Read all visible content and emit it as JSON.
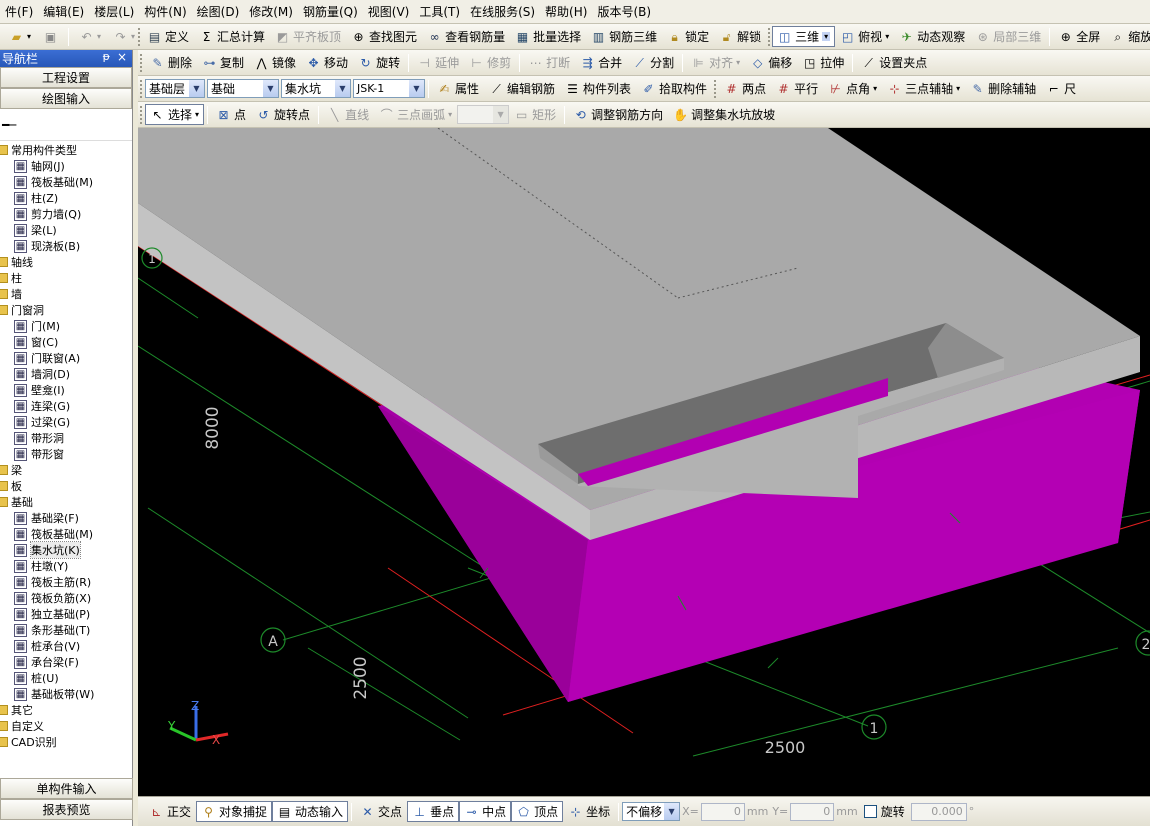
{
  "menu": [
    "件(F)",
    "编辑(E)",
    "楼层(L)",
    "构件(N)",
    "绘图(D)",
    "修改(M)",
    "钢筋量(Q)",
    "视图(V)",
    "工具(T)",
    "在线服务(S)",
    "帮助(H)",
    "版本号(B)"
  ],
  "toolbar1": {
    "define": "定义",
    "sum": "汇总计算",
    "flat_top": "平齐板顶",
    "find": "查找图元",
    "view_rebar": "查看钢筋量",
    "batch_select": "批量选择",
    "rebar_3d": "钢筋三维",
    "lock": "锁定",
    "unlock": "解锁",
    "view_3d": "三维",
    "top_view": "俯视",
    "dynamic_view": "动态观察",
    "local_3d": "局部三维",
    "fullscreen": "全屏",
    "zoom": "缩放"
  },
  "toolbar2": {
    "delete": "删除",
    "copy": "复制",
    "mirror": "镜像",
    "move": "移动",
    "rotate": "旋转",
    "extend": "延伸",
    "trim": "修剪",
    "break": "打断",
    "merge": "合并",
    "split": "分割",
    "align": "对齐",
    "offset": "偏移",
    "stretch": "拉伸",
    "set_grip": "设置夹点"
  },
  "toolbar3": {
    "floor": "基础层",
    "category": "基础",
    "type": "集水坑",
    "instance": "JSK-1",
    "property": "属性",
    "edit_rebar": "编辑钢筋",
    "component_list": "构件列表",
    "pick": "拾取构件",
    "two_point": "两点",
    "parallel": "平行",
    "point_angle": "点角",
    "three_point_axis": "三点辅轴",
    "delete_axis": "删除辅轴",
    "dimension": "尺"
  },
  "toolbar4": {
    "select": "选择",
    "point": "点",
    "rotate_point": "旋转点",
    "line": "直线",
    "arc": "三点画弧",
    "rect": "矩形",
    "adjust_rebar_dir": "调整钢筋方向",
    "adjust_slope": "调整集水坑放坡"
  },
  "panel": {
    "title": "导航栏",
    "pin": "ᵽ",
    "close": "×",
    "project_settings": "工程设置",
    "drawing_input": "绘图输入",
    "tree": [
      {
        "label": "常用构件类型",
        "kind": "folder",
        "level": 0
      },
      {
        "label": "轴网(J)",
        "kind": "leaf",
        "level": 1
      },
      {
        "label": "筏板基础(M)",
        "kind": "leaf",
        "level": 1
      },
      {
        "label": "柱(Z)",
        "kind": "leaf",
        "level": 1
      },
      {
        "label": "剪力墙(Q)",
        "kind": "leaf",
        "level": 1
      },
      {
        "label": "梁(L)",
        "kind": "leaf",
        "level": 1
      },
      {
        "label": "现浇板(B)",
        "kind": "leaf",
        "level": 1
      },
      {
        "label": "轴线",
        "kind": "folder",
        "level": 0
      },
      {
        "label": "柱",
        "kind": "folder",
        "level": 0
      },
      {
        "label": "墙",
        "kind": "folder",
        "level": 0
      },
      {
        "label": "门窗洞",
        "kind": "folder",
        "level": 0
      },
      {
        "label": "门(M)",
        "kind": "leaf",
        "level": 1
      },
      {
        "label": "窗(C)",
        "kind": "leaf",
        "level": 1
      },
      {
        "label": "门联窗(A)",
        "kind": "leaf",
        "level": 1
      },
      {
        "label": "墙洞(D)",
        "kind": "leaf",
        "level": 1
      },
      {
        "label": "壁龛(I)",
        "kind": "leaf",
        "level": 1
      },
      {
        "label": "连梁(G)",
        "kind": "leaf",
        "level": 1
      },
      {
        "label": "过梁(G)",
        "kind": "leaf",
        "level": 1
      },
      {
        "label": "带形洞",
        "kind": "leaf",
        "level": 1
      },
      {
        "label": "带形窗",
        "kind": "leaf",
        "level": 1
      },
      {
        "label": "梁",
        "kind": "folder",
        "level": 0
      },
      {
        "label": "板",
        "kind": "folder",
        "level": 0
      },
      {
        "label": "基础",
        "kind": "folder",
        "level": 0
      },
      {
        "label": "基础梁(F)",
        "kind": "leaf",
        "level": 1
      },
      {
        "label": "筏板基础(M)",
        "kind": "leaf",
        "level": 1
      },
      {
        "label": "集水坑(K)",
        "kind": "leaf",
        "level": 1,
        "selected": true
      },
      {
        "label": "柱墩(Y)",
        "kind": "leaf",
        "level": 1
      },
      {
        "label": "筏板主筋(R)",
        "kind": "leaf",
        "level": 1
      },
      {
        "label": "筏板负筋(X)",
        "kind": "leaf",
        "level": 1
      },
      {
        "label": "独立基础(P)",
        "kind": "leaf",
        "level": 1
      },
      {
        "label": "条形基础(T)",
        "kind": "leaf",
        "level": 1
      },
      {
        "label": "桩承台(V)",
        "kind": "leaf",
        "level": 1
      },
      {
        "label": "承台梁(F)",
        "kind": "leaf",
        "level": 1
      },
      {
        "label": "桩(U)",
        "kind": "leaf",
        "level": 1
      },
      {
        "label": "基础板带(W)",
        "kind": "leaf",
        "level": 1
      },
      {
        "label": "其它",
        "kind": "folder",
        "level": 0
      },
      {
        "label": "自定义",
        "kind": "folder",
        "level": 0
      },
      {
        "label": "CAD识别",
        "kind": "folder",
        "level": 0
      }
    ],
    "single_input": "单构件输入",
    "report_preview": "报表预览"
  },
  "viewport": {
    "dim_8000": "8000",
    "dim_2500_v": "2500",
    "dim_2500_h": "2500",
    "axis_a": "A",
    "axis_1": "1",
    "axis_2": "2",
    "axis_1_top": "1",
    "triad_z": "Z",
    "triad_y": "Y",
    "triad_x": "X",
    "colors": {
      "slab_top": "#a9a9a9",
      "slab_side": "#c3c3c3",
      "pit": "#b200b2",
      "pit_dark": "#8a008a",
      "grid": "#1d8a2a",
      "edge": "#e02020"
    }
  },
  "statusbar": {
    "orthogonal": "正交",
    "snap": "对象捕捉",
    "dynamic_input": "动态输入",
    "intersection": "交点",
    "perpendicular": "垂点",
    "midpoint": "中点",
    "vertex": "顶点",
    "coordinate": "坐标",
    "offset_mode": "不偏移",
    "x_label": "X=",
    "x_value": "0",
    "y_label": "Y=",
    "y_value": "0",
    "unit": "mm",
    "rotate": "旋转",
    "rotate_value": "0.000",
    "degree": "°"
  }
}
